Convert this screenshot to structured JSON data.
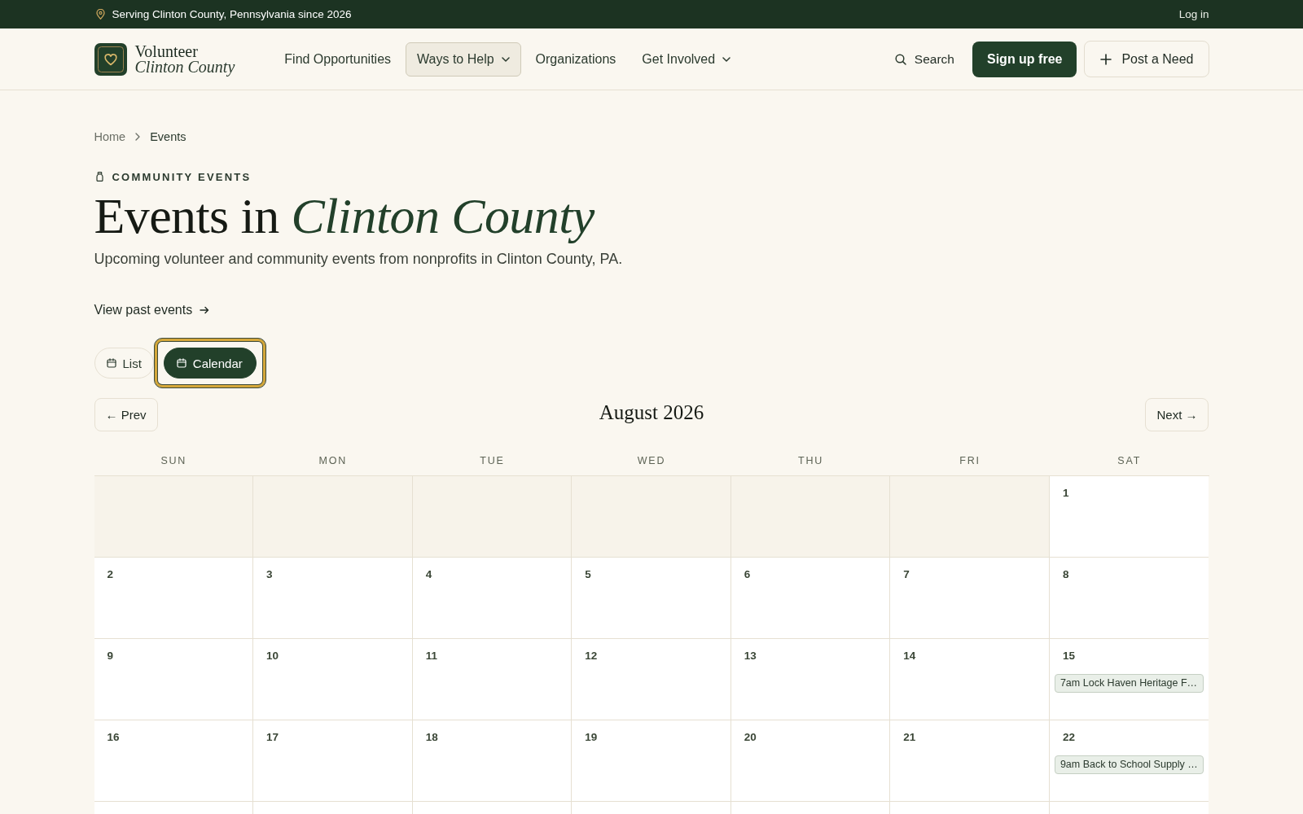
{
  "top_bar": {
    "location": "Serving Clinton County, Pennsylvania since 2026",
    "login": "Log in"
  },
  "header": {
    "logo": {
      "line_1": "Volunteer",
      "line_2": "Clinton County"
    },
    "nav": [
      {
        "label": "Find Opportunities",
        "kind": "link",
        "selected": false
      },
      {
        "label": "Ways to Help",
        "kind": "dropdown",
        "selected": true
      },
      {
        "label": "Organizations",
        "kind": "link",
        "selected": false
      },
      {
        "label": "Get Involved",
        "kind": "dropdown",
        "selected": false
      }
    ],
    "search": "Search",
    "signup_button": "Sign up free",
    "post_button": "Post a Need"
  },
  "breadcrumb": [
    {
      "label": "Home",
      "current": false
    },
    {
      "label": "Events",
      "current": true
    }
  ],
  "eyebrow": "COMMUNITY EVENTS",
  "title": "Events in *Clinton County*",
  "subtitle": "Upcoming volunteer and community events from nonprofits in Clinton County, PA.",
  "past_events_link": "View past events",
  "view_tabs": [
    {
      "label": "List",
      "selected": false,
      "focused": false
    },
    {
      "label": "Calendar",
      "selected": true,
      "focused": true
    }
  ],
  "calendar": {
    "month": "August 2026",
    "prev": "← Prev",
    "next": "Next →",
    "weekdays": [
      "SUN",
      "MON",
      "TUE",
      "WED",
      "THU",
      "FRI",
      "SAT"
    ],
    "weeks": [
      [
        {
          "outside_month": true
        },
        {
          "outside_month": true
        },
        {
          "outside_month": true
        },
        {
          "outside_month": true
        },
        {
          "outside_month": true
        },
        {
          "outside_month": true
        },
        {
          "outside_month": false,
          "day": "1"
        }
      ],
      [
        {
          "outside_month": false,
          "day": "2"
        },
        {
          "outside_month": false,
          "day": "3"
        },
        {
          "outside_month": false,
          "day": "4"
        },
        {
          "outside_month": false,
          "day": "5"
        },
        {
          "outside_month": false,
          "day": "6"
        },
        {
          "outside_month": false,
          "day": "7"
        },
        {
          "outside_month": false,
          "day": "8"
        }
      ],
      [
        {
          "outside_month": false,
          "day": "9"
        },
        {
          "outside_month": false,
          "day": "10"
        },
        {
          "outside_month": false,
          "day": "11"
        },
        {
          "outside_month": false,
          "day": "12"
        },
        {
          "outside_month": false,
          "day": "13"
        },
        {
          "outside_month": false,
          "day": "14"
        },
        {
          "outside_month": false,
          "day": "15",
          "events": [
            {
              "time": "7am",
              "title": "Lock Haven Heritage F…"
            }
          ]
        }
      ],
      [
        {
          "outside_month": false,
          "day": "16"
        },
        {
          "outside_month": false,
          "day": "17"
        },
        {
          "outside_month": false,
          "day": "18"
        },
        {
          "outside_month": false,
          "day": "19"
        },
        {
          "outside_month": false,
          "day": "20"
        },
        {
          "outside_month": false,
          "day": "21"
        },
        {
          "outside_month": false,
          "day": "22",
          "events": [
            {
              "time": "9am",
              "title": "Back to School Supply …"
            }
          ]
        }
      ]
    ]
  }
}
